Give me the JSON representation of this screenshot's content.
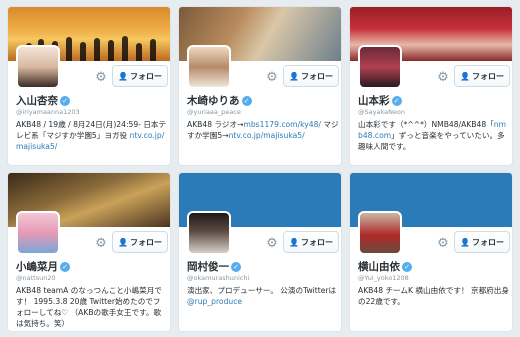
{
  "follow_label": "フォロー",
  "accent_color": "#2b7bb9",
  "cards": [
    {
      "name": "入山杏奈",
      "handle": "@iriyamaanna1203",
      "bio_text": "AKB48 / 19歳 / 8月24日(月)24:59- 日本テレビ系「マジすか学園5」ヨガ役",
      "bio_link": "ntv.co.jp/majisuka5/",
      "banner": "sunset-beach"
    },
    {
      "name": "木崎ゆりあ",
      "handle": "@yuriaaa_peace",
      "bio_text": "AKB48 ラジオ→",
      "bio_link": "mbs1179.com/ky48/",
      "bio_text2": " マジすか学園5→",
      "bio_link2": "ntv.co.jp/majisuka5/",
      "banner": "street-hug"
    },
    {
      "name": "山本彩",
      "handle": "@SayakaNeon",
      "bio_text": "山本彩です（*^^*）NMB48/AKB48「",
      "bio_link": "nmb48.com",
      "bio_text2": "」ずっと音楽をやっていたい。多趣味人間です。",
      "banner": "group-crowd"
    },
    {
      "name": "小嶋菜月",
      "handle": "@nattsun20",
      "bio_text": "AKB48 teamA のなっつんこと小嶋菜月です！ 1995.3.8 20歳 Twitter始めたのでフォローしてね♡ （AKBの歌手女王です。歌は気持ち。笑）",
      "banner": "theme-park"
    },
    {
      "name": "岡村俊一",
      "handle": "@okamurashunichi",
      "bio_text": "演出家、プロデューサー。 公演のTwitterは",
      "bio_link": "@rup_produce",
      "banner": "blue"
    },
    {
      "name": "横山由依",
      "handle": "@Yui_yoko1208",
      "bio_text": "AKB48 チームK 横山由依です！ 京都府出身の22歳です。",
      "banner": "blue"
    }
  ],
  "icons": {
    "gear": "gear-icon",
    "follow": "add-user-icon",
    "verified": "verified-badge-icon"
  }
}
